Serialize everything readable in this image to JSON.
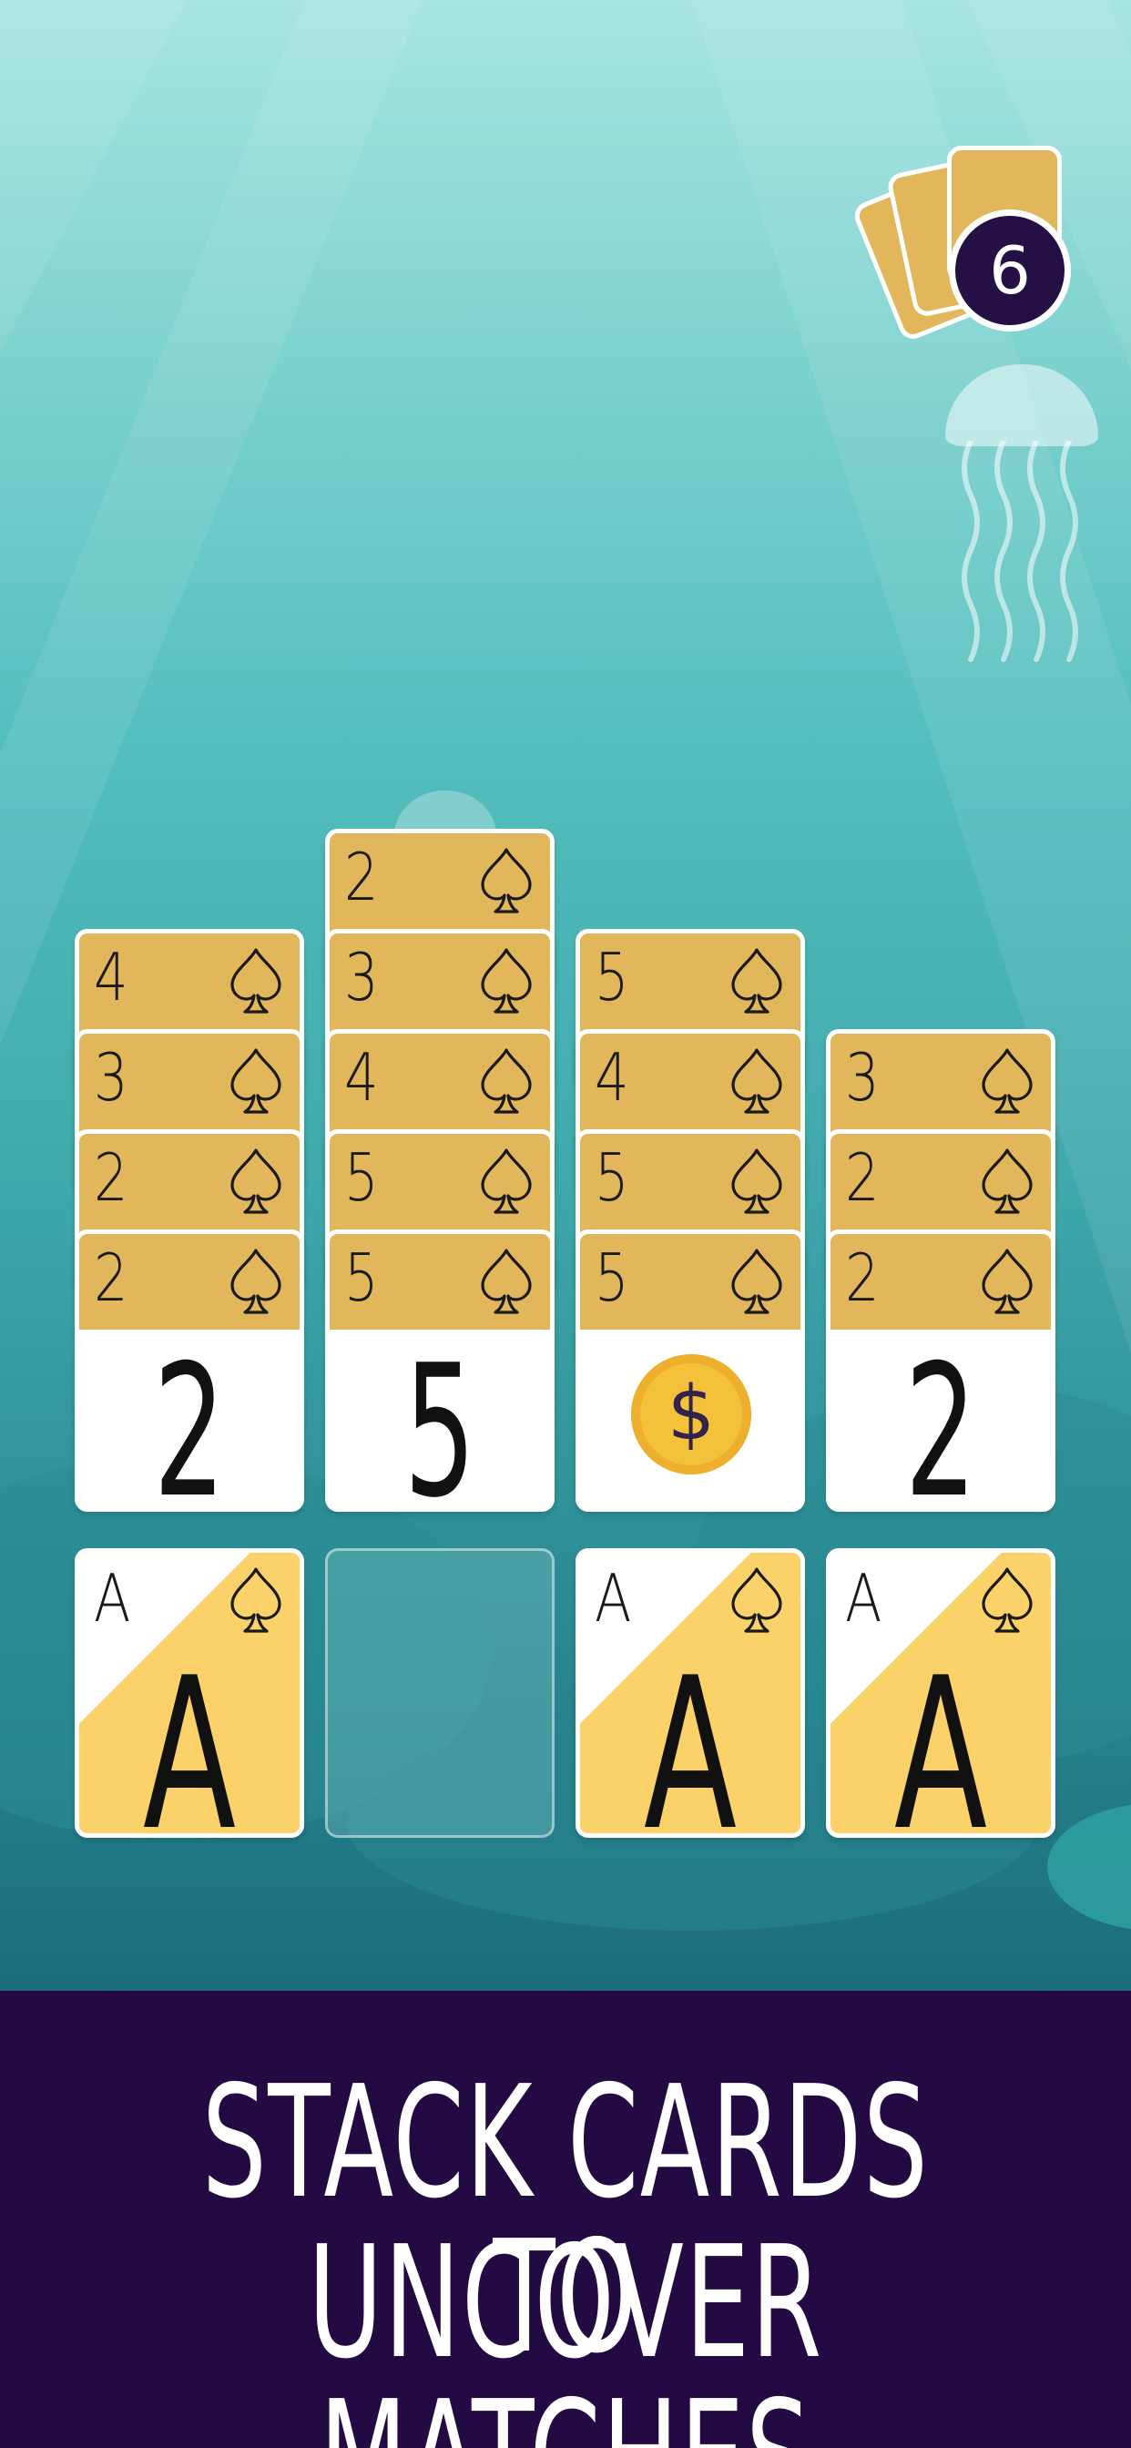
{
  "deck": {
    "remaining": "6"
  },
  "columns": [
    {
      "stack": [
        {
          "rank": "4",
          "suit": "spade"
        },
        {
          "rank": "3",
          "suit": "spade"
        },
        {
          "rank": "2",
          "suit": "spade"
        }
      ],
      "face": {
        "type": "number",
        "value": "2",
        "rank": "2"
      }
    },
    {
      "stack": [
        {
          "rank": "2",
          "suit": "spade"
        },
        {
          "rank": "3",
          "suit": "spade"
        },
        {
          "rank": "4",
          "suit": "spade"
        },
        {
          "rank": "5",
          "suit": "spade"
        }
      ],
      "face": {
        "type": "number",
        "value": "5",
        "rank": "5"
      }
    },
    {
      "stack": [
        {
          "rank": "5",
          "suit": "spade"
        },
        {
          "rank": "4",
          "suit": "spade"
        },
        {
          "rank": "5",
          "suit": "spade"
        }
      ],
      "face": {
        "type": "coin",
        "value": "$",
        "rank": "5"
      }
    },
    {
      "stack": [
        {
          "rank": "3",
          "suit": "spade"
        },
        {
          "rank": "2",
          "suit": "spade"
        }
      ],
      "face": {
        "type": "number",
        "value": "2",
        "rank": "2"
      }
    }
  ],
  "foundation": [
    {
      "rank": "A",
      "big": "A",
      "suit": "spade",
      "empty": false
    },
    {
      "empty": true
    },
    {
      "rank": "A",
      "big": "A",
      "suit": "spade",
      "empty": false
    },
    {
      "rank": "A",
      "big": "A",
      "suit": "spade",
      "empty": false
    }
  ],
  "banner": {
    "line1": "STACK CARDS TO",
    "line2": "UNCOVER MATCHES"
  },
  "colors": {
    "card_gold": "#e2b65a",
    "ace_gold": "#fbd26a",
    "banner": "#230a43",
    "badge": "#241044"
  },
  "icons": {
    "suit": "spade-icon",
    "coin": "dollar-coin-icon",
    "deck": "card-deck-icon"
  }
}
